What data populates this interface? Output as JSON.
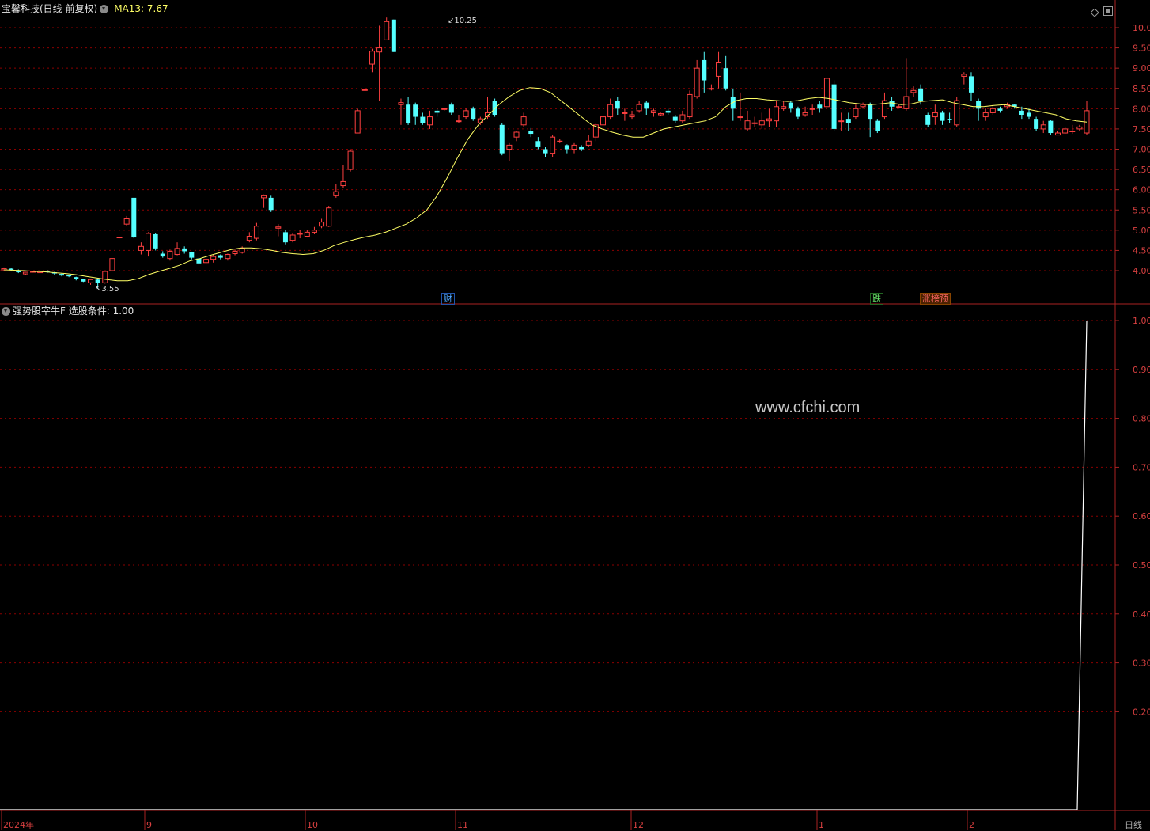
{
  "header": {
    "stock_title": "宝馨科技(日线 前复权)",
    "ma_label": "MA13: 7.67"
  },
  "indicator": {
    "title": "强势股宰牛F",
    "condition": "选股条件: 1.00"
  },
  "watermark": "www.cfchi.com",
  "price_annotations": {
    "high": "10.25",
    "low": "3.55"
  },
  "markers": [
    {
      "id": "cai",
      "text": "财",
      "color": "#4da6ff"
    },
    {
      "id": "die",
      "text": "跌",
      "color": "#66dd66"
    },
    {
      "id": "zhang",
      "text": "涨榜预",
      "color": "#ff6666"
    }
  ],
  "period_label": "日线",
  "x_labels": [
    "2024年",
    "9",
    "10",
    "11",
    "12",
    "1",
    "2"
  ],
  "colors": {
    "up": "#ff4040",
    "down": "#54ffff",
    "ma": "#ffff66",
    "grid": "#8b0000",
    "axis": "#aa2222"
  },
  "chart_data": [
    {
      "type": "candlestick",
      "y_ticks": [
        "10.00",
        "9.50",
        "9.00",
        "8.50",
        "8.00",
        "7.50",
        "7.00",
        "6.50",
        "6.00",
        "5.50",
        "5.00",
        "4.50",
        "4.00"
      ],
      "ylim": [
        3.55,
        10.25
      ],
      "series": [
        {
          "name": "MA13",
          "values": [
            4.02,
            4.01,
            4.0,
            3.98,
            3.97,
            3.95,
            3.93,
            3.9,
            3.86,
            3.82,
            3.78,
            3.75,
            3.75,
            3.8,
            3.9,
            3.98,
            4.05,
            4.13,
            4.24,
            4.3,
            4.38,
            4.45,
            4.52,
            4.56,
            4.56,
            4.54,
            4.5,
            4.45,
            4.42,
            4.4,
            4.42,
            4.5,
            4.62,
            4.7,
            4.77,
            4.83,
            4.88,
            4.95,
            5.05,
            5.15,
            5.3,
            5.5,
            5.85,
            6.3,
            6.8,
            7.25,
            7.6,
            7.85,
            8.1,
            8.3,
            8.45,
            8.52,
            8.5,
            8.4,
            8.2,
            8.0,
            7.8,
            7.6,
            7.5,
            7.42,
            7.35,
            7.3,
            7.3,
            7.4,
            7.5,
            7.55,
            7.6,
            7.65,
            7.7,
            7.8,
            8.05,
            8.2,
            8.25,
            8.25,
            8.22,
            8.2,
            8.18,
            8.2,
            8.25,
            8.28,
            8.25,
            8.2,
            8.15,
            8.12,
            8.1,
            8.12,
            8.15,
            8.1,
            8.12,
            8.18,
            8.2,
            8.22,
            8.15,
            8.1,
            8.05,
            8.05,
            8.08,
            8.1,
            8.05,
            8.0,
            7.95,
            7.9,
            7.85,
            7.75,
            7.7,
            7.67
          ]
        },
        {
          "name": "candles",
          "values": [
            [
              4.02,
              4.05,
              4.08,
              3.99
            ],
            [
              4.05,
              4.01,
              4.06,
              3.98
            ],
            [
              4.01,
              3.96,
              4.03,
              3.94
            ],
            [
              3.92,
              3.96,
              3.97,
              3.9
            ],
            [
              3.97,
              3.98,
              4.0,
              3.95
            ],
            [
              3.95,
              3.99,
              4.0,
              3.94
            ],
            [
              4.0,
              3.96,
              4.02,
              3.94
            ],
            [
              3.96,
              3.93,
              3.97,
              3.9
            ],
            [
              3.92,
              3.88,
              3.93,
              3.86
            ],
            [
              3.89,
              3.86,
              3.9,
              3.84
            ],
            [
              3.84,
              3.79,
              3.85,
              3.76
            ],
            [
              3.79,
              3.73,
              3.8,
              3.72
            ],
            [
              3.7,
              3.78,
              3.8,
              3.65
            ],
            [
              3.78,
              3.7,
              3.8,
              3.55
            ],
            [
              3.7,
              3.98,
              4.0,
              3.68
            ],
            [
              4.0,
              4.3,
              4.31,
              3.98
            ],
            [
              4.82,
              4.83,
              4.84,
              4.8
            ],
            [
              5.15,
              5.28,
              5.35,
              5.1
            ],
            [
              5.8,
              4.82,
              5.8,
              4.8
            ],
            [
              4.5,
              4.6,
              4.7,
              4.4
            ],
            [
              4.5,
              4.92,
              4.95,
              4.35
            ],
            [
              4.9,
              4.55,
              4.92,
              4.5
            ],
            [
              4.42,
              4.35,
              4.48,
              4.32
            ],
            [
              4.3,
              4.48,
              4.52,
              4.25
            ],
            [
              4.4,
              4.55,
              4.7,
              4.38
            ],
            [
              4.55,
              4.48,
              4.6,
              4.42
            ],
            [
              4.45,
              4.32,
              4.47,
              4.28
            ],
            [
              4.3,
              4.18,
              4.32,
              4.15
            ],
            [
              4.2,
              4.28,
              4.32,
              4.15
            ],
            [
              4.28,
              4.35,
              4.4,
              4.2
            ],
            [
              4.38,
              4.32,
              4.4,
              4.28
            ],
            [
              4.3,
              4.4,
              4.42,
              4.25
            ],
            [
              4.42,
              4.48,
              4.52,
              4.38
            ],
            [
              4.45,
              4.55,
              4.6,
              4.42
            ],
            [
              4.75,
              4.85,
              4.95,
              4.7
            ],
            [
              4.8,
              5.1,
              5.18,
              4.75
            ],
            [
              5.8,
              5.85,
              5.88,
              5.55
            ],
            [
              5.8,
              5.5,
              5.85,
              5.45
            ],
            [
              5.05,
              5.08,
              5.15,
              4.85
            ],
            [
              4.95,
              4.7,
              5.0,
              4.65
            ],
            [
              4.75,
              4.88,
              4.92,
              4.7
            ],
            [
              4.9,
              4.92,
              5.0,
              4.8
            ],
            [
              4.85,
              4.95,
              5.0,
              4.82
            ],
            [
              4.95,
              5.0,
              5.08,
              4.9
            ],
            [
              5.1,
              5.2,
              5.28,
              5.05
            ],
            [
              5.1,
              5.55,
              5.6,
              5.08
            ],
            [
              5.85,
              5.95,
              6.15,
              5.8
            ],
            [
              6.1,
              6.2,
              6.6,
              6.05
            ],
            [
              6.5,
              6.95,
              7.0,
              6.45
            ],
            [
              7.4,
              7.95,
              8.0,
              7.4
            ],
            [
              8.45,
              8.47,
              8.5,
              8.45
            ],
            [
              9.1,
              9.42,
              9.48,
              8.9
            ],
            [
              9.4,
              9.5,
              10.05,
              8.2
            ],
            [
              9.7,
              10.15,
              10.25,
              9.7
            ],
            [
              10.2,
              9.4,
              10.2,
              9.4
            ],
            [
              8.1,
              8.15,
              8.25,
              7.6
            ],
            [
              8.1,
              7.65,
              8.3,
              7.6
            ],
            [
              8.1,
              7.8,
              8.15,
              7.6
            ],
            [
              7.8,
              7.65,
              7.9,
              7.6
            ],
            [
              7.6,
              7.8,
              7.95,
              7.5
            ],
            [
              7.95,
              7.9,
              8.0,
              7.8
            ],
            [
              8.0,
              8.0,
              8.02,
              7.95
            ],
            [
              8.1,
              7.9,
              8.15,
              7.85
            ],
            [
              7.7,
              7.7,
              7.85,
              7.65
            ],
            [
              7.8,
              7.95,
              8.0,
              7.75
            ],
            [
              8.0,
              7.75,
              8.05,
              7.7
            ],
            [
              7.65,
              7.75,
              7.8,
              7.6
            ],
            [
              7.8,
              7.9,
              8.3,
              7.75
            ],
            [
              8.2,
              7.85,
              8.25,
              7.8
            ],
            [
              7.6,
              6.9,
              7.65,
              6.85
            ],
            [
              7.0,
              7.1,
              7.15,
              6.7
            ],
            [
              7.3,
              7.42,
              7.45,
              7.2
            ],
            [
              7.6,
              7.8,
              7.9,
              7.55
            ],
            [
              7.45,
              7.38,
              7.52,
              7.3
            ],
            [
              7.2,
              7.05,
              7.3,
              7.0
            ],
            [
              7.0,
              6.9,
              7.05,
              6.8
            ],
            [
              6.9,
              7.3,
              7.35,
              6.8
            ],
            [
              7.2,
              7.2,
              7.25,
              7.15
            ],
            [
              7.1,
              7.0,
              7.12,
              6.9
            ],
            [
              7.0,
              7.1,
              7.15,
              6.9
            ],
            [
              7.05,
              7.0,
              7.1,
              6.95
            ],
            [
              7.1,
              7.2,
              7.35,
              7.05
            ],
            [
              7.3,
              7.6,
              7.65,
              7.2
            ],
            [
              7.6,
              7.8,
              8.0,
              7.55
            ],
            [
              7.8,
              8.1,
              8.25,
              7.75
            ],
            [
              8.2,
              8.0,
              8.3,
              7.85
            ],
            [
              7.9,
              7.9,
              8.0,
              7.7
            ],
            [
              7.8,
              7.85,
              7.95,
              7.75
            ],
            [
              7.95,
              8.1,
              8.2,
              7.9
            ],
            [
              8.15,
              8.0,
              8.2,
              7.85
            ],
            [
              7.9,
              7.95,
              8.0,
              7.8
            ],
            [
              7.85,
              7.88,
              7.9,
              7.82
            ],
            [
              7.95,
              7.9,
              8.0,
              7.85
            ],
            [
              7.8,
              7.7,
              7.85,
              7.65
            ],
            [
              7.7,
              7.85,
              7.95,
              7.65
            ],
            [
              7.8,
              8.35,
              8.45,
              7.75
            ],
            [
              8.3,
              9.0,
              9.2,
              8.25
            ],
            [
              9.2,
              8.7,
              9.4,
              8.4
            ],
            [
              8.5,
              8.5,
              8.6,
              8.45
            ],
            [
              8.8,
              9.15,
              9.4,
              8.5
            ],
            [
              9.0,
              8.5,
              9.3,
              8.45
            ],
            [
              8.3,
              8.0,
              8.5,
              7.7
            ],
            [
              7.8,
              7.8,
              8.4,
              7.7
            ],
            [
              7.5,
              7.7,
              7.95,
              7.45
            ],
            [
              7.65,
              7.65,
              7.8,
              7.55
            ],
            [
              7.6,
              7.7,
              7.9,
              7.5
            ],
            [
              7.7,
              7.75,
              8.0,
              7.55
            ],
            [
              7.7,
              8.05,
              8.2,
              7.55
            ],
            [
              8.0,
              8.05,
              8.2,
              7.95
            ],
            [
              8.15,
              8.0,
              8.2,
              7.9
            ],
            [
              8.0,
              7.8,
              8.05,
              7.75
            ],
            [
              7.85,
              7.9,
              8.05,
              7.8
            ],
            [
              8.0,
              8.0,
              8.1,
              7.85
            ],
            [
              8.1,
              8.0,
              8.2,
              7.9
            ],
            [
              8.05,
              8.75,
              8.75,
              8.0
            ],
            [
              8.6,
              7.5,
              8.7,
              7.45
            ],
            [
              7.7,
              7.7,
              7.9,
              7.45
            ],
            [
              7.75,
              7.65,
              7.9,
              7.45
            ],
            [
              7.8,
              8.0,
              8.1,
              7.75
            ],
            [
              8.05,
              8.1,
              8.15,
              8.0
            ],
            [
              8.1,
              7.75,
              8.15,
              7.3
            ],
            [
              7.7,
              7.45,
              7.75,
              7.4
            ],
            [
              7.8,
              8.2,
              8.4,
              7.75
            ],
            [
              8.2,
              8.05,
              8.3,
              7.95
            ],
            [
              8.05,
              8.05,
              8.1,
              8.0
            ],
            [
              8.0,
              8.3,
              9.25,
              7.95
            ],
            [
              8.4,
              8.45,
              8.55,
              8.3
            ],
            [
              8.5,
              8.2,
              8.6,
              8.1
            ],
            [
              7.85,
              7.6,
              7.9,
              7.55
            ],
            [
              7.8,
              7.9,
              8.1,
              7.6
            ],
            [
              7.9,
              7.7,
              7.95,
              7.6
            ],
            [
              7.75,
              7.72,
              7.9,
              7.65
            ],
            [
              7.6,
              8.2,
              8.3,
              7.55
            ],
            [
              8.8,
              8.85,
              8.9,
              8.6
            ],
            [
              8.8,
              8.4,
              8.9,
              8.2
            ],
            [
              8.2,
              8.0,
              8.25,
              7.7
            ],
            [
              7.8,
              7.9,
              8.0,
              7.7
            ],
            [
              7.9,
              8.0,
              8.1,
              7.85
            ],
            [
              8.0,
              7.95,
              8.05,
              7.9
            ],
            [
              8.05,
              8.1,
              8.15,
              8.0
            ],
            [
              8.1,
              8.05,
              8.12,
              8.0
            ],
            [
              7.95,
              7.85,
              8.05,
              7.75
            ],
            [
              7.9,
              7.8,
              8.0,
              7.75
            ],
            [
              7.75,
              7.5,
              7.8,
              7.45
            ],
            [
              7.5,
              7.6,
              7.7,
              7.4
            ],
            [
              7.7,
              7.4,
              7.72,
              7.35
            ],
            [
              7.35,
              7.4,
              7.45,
              7.35
            ],
            [
              7.4,
              7.5,
              7.55,
              7.38
            ],
            [
              7.45,
              7.45,
              7.6,
              7.38
            ],
            [
              7.5,
              7.55,
              7.6,
              7.45
            ],
            [
              7.4,
              7.95,
              8.2,
              7.35
            ]
          ]
        }
      ]
    },
    {
      "type": "line",
      "series": [
        {
          "name": "选股条件",
          "values": [
            0,
            0,
            0,
            0,
            1
          ]
        }
      ],
      "y_ticks": [
        "1.00",
        "0.90",
        "0.80",
        "0.70",
        "0.60",
        "0.50",
        "0.40",
        "0.30",
        "0.20"
      ],
      "ylim": [
        0,
        1
      ]
    }
  ]
}
